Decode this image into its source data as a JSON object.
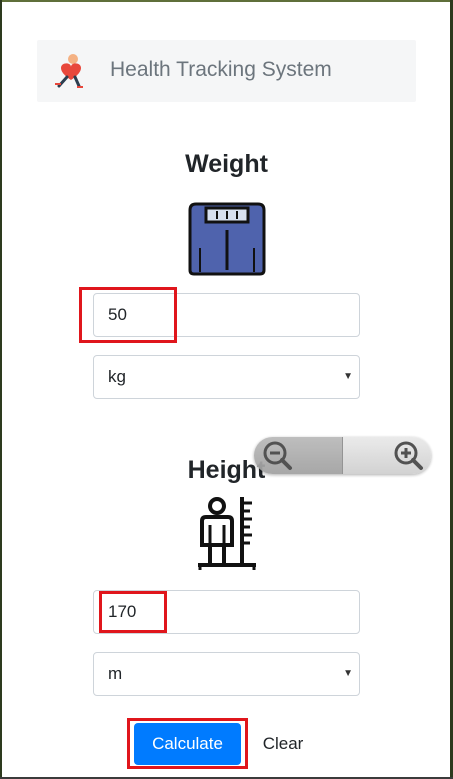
{
  "navbar": {
    "title": "Health Tracking System",
    "logo_icon": "runner-heart-logo-icon"
  },
  "weight": {
    "title": "Weight",
    "icon": "bathroom-scale-icon",
    "value": "50",
    "unit": "kg"
  },
  "height": {
    "title": "Height",
    "icon": "height-measure-icon",
    "value": "170",
    "unit": "m"
  },
  "actions": {
    "calculate": "Calculate",
    "clear": "Clear"
  },
  "zoom": {
    "zoom_out_icon": "zoom-out-icon",
    "zoom_in_icon": "zoom-in-icon"
  },
  "colors": {
    "primary": "#007bff",
    "highlight": "#e0161c",
    "scale_body": "#4f63ad"
  }
}
